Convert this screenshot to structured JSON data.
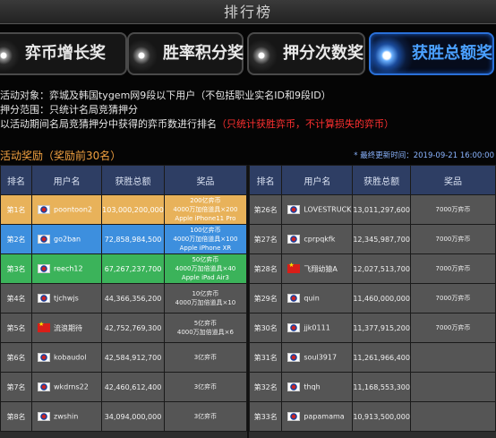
{
  "header": {
    "title": "排行榜"
  },
  "tabs": [
    {
      "label": "弈币增长奖"
    },
    {
      "label": "胜率积分奖"
    },
    {
      "label": "押分次数奖"
    },
    {
      "label": "获胜总额奖",
      "active": true
    }
  ],
  "info": {
    "line1": "活动对象：弈城及韩国tygem网9段以下用户（不包括职业实名ID和9段ID）",
    "line2": "押分范围：只统计名局竞猜押分",
    "line3_prefix": "以活动期间名局竞猜押分中获得的弈币数进行排名",
    "line3_red": "（只统计获胜弈币，不计算损失的弈币）"
  },
  "section": {
    "title": "活动奖励（奖励前30名）",
    "updated": "* 最终更新时间：2019-09-21 16:00:00"
  },
  "table": {
    "headers": [
      "排名",
      "用户名",
      "获胜总额",
      "奖品"
    ],
    "left_rows": [
      {
        "rank": "第1名",
        "flag": "kr",
        "user": "poontoon2",
        "amount": "103,000,200,000",
        "prize1": "200亿弈币",
        "prize2": "4000万加倍道具×200",
        "prize3": "Apple iPhone11 Pro"
      },
      {
        "rank": "第2名",
        "flag": "kr",
        "user": "go2ban",
        "amount": "72,858,984,500",
        "prize1": "100亿弈币",
        "prize2": "4000万加倍道具×100",
        "prize3": "Apple iPhone XR"
      },
      {
        "rank": "第3名",
        "flag": "kr",
        "user": "reech12",
        "amount": "67,267,237,700",
        "prize1": "50亿弈币",
        "prize2": "4000万加倍道具×40",
        "prize3": "Apple iPad Air3"
      },
      {
        "rank": "第4名",
        "flag": "kr",
        "user": "tjchwjs",
        "amount": "44,366,356,200",
        "prize1": "10亿弈币",
        "prize2": "4000万加倍道具×10",
        "prize3": ""
      },
      {
        "rank": "第5名",
        "flag": "cn",
        "user": "流浪期待",
        "amount": "42,752,769,300",
        "prize1": "5亿弈币",
        "prize2": "4000万加倍道具×6",
        "prize3": ""
      },
      {
        "rank": "第6名",
        "flag": "kr",
        "user": "kobaudol",
        "amount": "42,584,912,700",
        "prize1": "3亿弈币",
        "prize2": "",
        "prize3": ""
      },
      {
        "rank": "第7名",
        "flag": "kr",
        "user": "wkdrns22",
        "amount": "42,460,612,400",
        "prize1": "3亿弈币",
        "prize2": "",
        "prize3": ""
      },
      {
        "rank": "第8名",
        "flag": "kr",
        "user": "zwshin",
        "amount": "34,094,000,000",
        "prize1": "3亿弈币",
        "prize2": "",
        "prize3": ""
      }
    ],
    "right_rows": [
      {
        "rank": "第26名",
        "flag": "kr",
        "user": "LOVESTRUCK",
        "amount": "13,011,297,600",
        "prize": "7000万弈币"
      },
      {
        "rank": "第27名",
        "flag": "kr",
        "user": "cprpqkfk",
        "amount": "12,345,987,700",
        "prize": "7000万弈币"
      },
      {
        "rank": "第28名",
        "flag": "cn",
        "user": "飞翔幼猿A",
        "amount": "12,027,513,700",
        "prize": "7000万弈币"
      },
      {
        "rank": "第29名",
        "flag": "kr",
        "user": "quin",
        "amount": "11,460,000,000",
        "prize": "7000万弈币"
      },
      {
        "rank": "第30名",
        "flag": "kr",
        "user": "jjk0111",
        "amount": "11,377,915,200",
        "prize": "7000万弈币"
      },
      {
        "rank": "第31名",
        "flag": "kr",
        "user": "soul3917",
        "amount": "11,261,966,400",
        "prize": ""
      },
      {
        "rank": "第32名",
        "flag": "kr",
        "user": "thqh",
        "amount": "11,168,553,300",
        "prize": ""
      },
      {
        "rank": "第33名",
        "flag": "kr",
        "user": "papamama",
        "amount": "10,913,500,000",
        "prize": ""
      }
    ]
  },
  "colors": {
    "gold": "#e8b25a",
    "blue": "#3d8fde",
    "green": "#3bb35a",
    "tab_active": "#4aa0ff",
    "notice_red": "#ff3030"
  }
}
